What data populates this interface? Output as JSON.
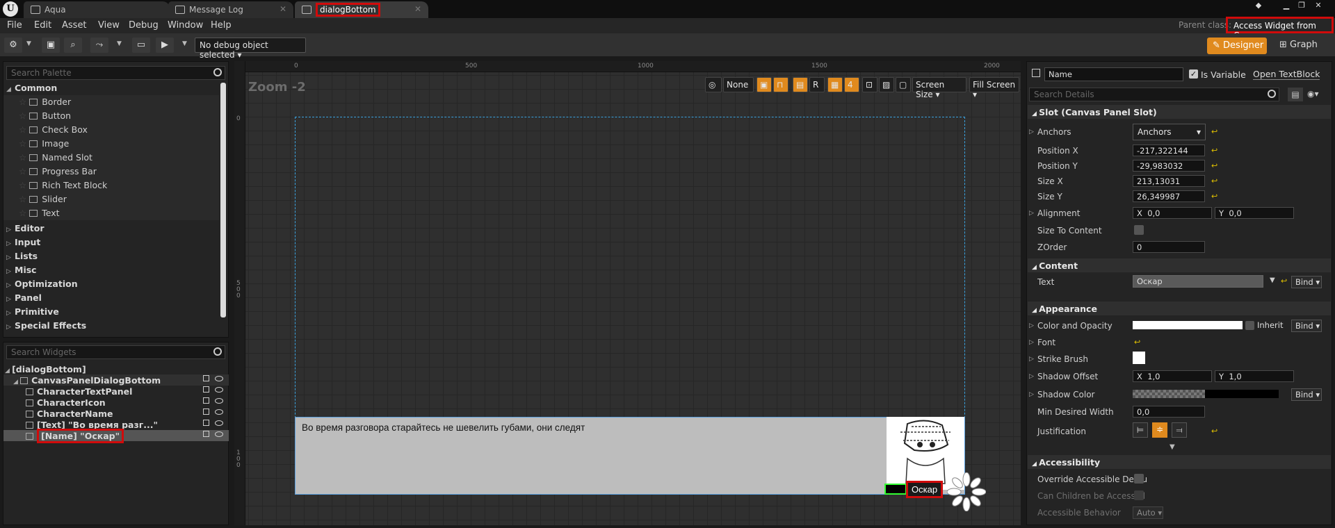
{
  "tabs": [
    {
      "label": "Aqua",
      "active": false
    },
    {
      "label": "Message Log",
      "active": false
    },
    {
      "label": "dialogBottom",
      "active": true
    }
  ],
  "menu": [
    "File",
    "Edit",
    "Asset",
    "View",
    "Debug",
    "Window",
    "Help"
  ],
  "parent_class": {
    "label": "Parent class:",
    "value": "Access Widget from Cpp"
  },
  "toolbar": {
    "debug_select": "No debug object selected",
    "designer": "Designer",
    "graph": "Graph"
  },
  "palette": {
    "search_placeholder": "Search Palette",
    "open_category": "Common",
    "common_items": [
      "Border",
      "Button",
      "Check Box",
      "Image",
      "Named Slot",
      "Progress Bar",
      "Rich Text Block",
      "Slider",
      "Text"
    ],
    "categories": [
      "Editor",
      "Input",
      "Lists",
      "Misc",
      "Optimization",
      "Panel",
      "Primitive",
      "Special Effects"
    ]
  },
  "hierarchy": {
    "search_placeholder": "Search Widgets",
    "root": "[dialogBottom]",
    "items": [
      {
        "label": "CanvasPanelDialogBottom"
      },
      {
        "label": "CharacterTextPanel"
      },
      {
        "label": "CharacterIcon"
      },
      {
        "label": "CharacterName"
      },
      {
        "label": "[Text] \"Во время разг...\""
      },
      {
        "label": "[Name] \"Оскар\"",
        "selected": true
      }
    ]
  },
  "viewport": {
    "zoom": "Zoom -2",
    "ruler_x": [
      "0",
      "500",
      "1000",
      "1500",
      "2000"
    ],
    "ruler_y": [
      "0",
      "5\n0\n0",
      "1\n0\n0"
    ],
    "buttons": [
      "None",
      "R",
      "4",
      "Screen Size",
      "Fill Screen"
    ],
    "dialog_text": "Во время разговора старайтесь не шевелить губами, они следят",
    "character_name": "Оскар"
  },
  "details": {
    "name_field": "Name",
    "is_variable": "Is Variable",
    "open_textblock": "Open TextBlock",
    "search_placeholder": "Search Details",
    "slot_section": "Slot (Canvas Panel Slot)",
    "anchors_label": "Anchors",
    "anchors_value": "Anchors",
    "position_x_label": "Position X",
    "position_x": "-217,322144",
    "position_y_label": "Position Y",
    "position_y": "-29,983032",
    "size_x_label": "Size X",
    "size_x": "213,13031",
    "size_y_label": "Size Y",
    "size_y": "26,349987",
    "alignment_label": "Alignment",
    "alignment_x": "0,0",
    "alignment_y": "0,0",
    "size_to_content": "Size To Content",
    "zorder_label": "ZOrder",
    "zorder": "0",
    "content_section": "Content",
    "text_label": "Text",
    "text_value": "Оскар",
    "bind": "Bind",
    "appearance_section": "Appearance",
    "color_label": "Color and Opacity",
    "inherit": "Inherit",
    "font_label": "Font",
    "strike_label": "Strike Brush",
    "shadow_offset_label": "Shadow Offset",
    "shadow_offset_x": "1,0",
    "shadow_offset_y": "1,0",
    "shadow_color_label": "Shadow Color",
    "min_width_label": "Min Desired Width",
    "min_width": "0,0",
    "justification_label": "Justification",
    "accessibility_section": "Accessibility",
    "override_label": "Override Accessible Defau",
    "children_label": "Can Children be Accessibl",
    "behavior_label": "Accessible Behavior",
    "behavior_value": "Auto"
  },
  "colors": {
    "accent": "#e08a1e",
    "highlight": "#d10b0b",
    "selection": "#3aa3e0"
  }
}
